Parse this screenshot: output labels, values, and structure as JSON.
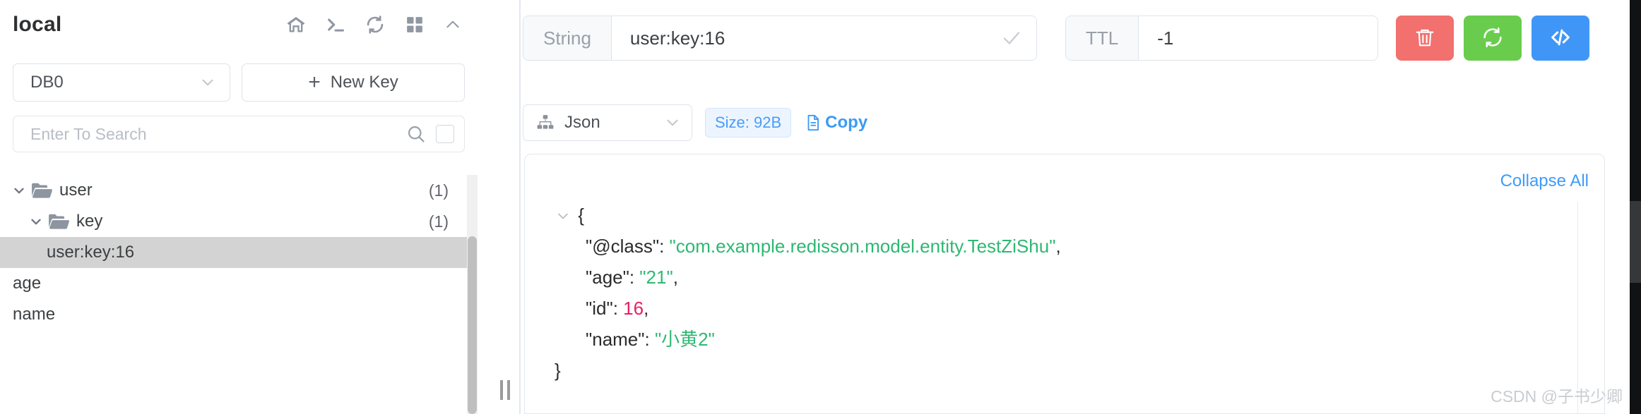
{
  "sidebar": {
    "connection_name": "local",
    "header_icons": [
      {
        "name": "home-icon",
        "label": "Home"
      },
      {
        "name": "terminal-icon",
        "label": "Console"
      },
      {
        "name": "refresh-icon",
        "label": "Refresh"
      },
      {
        "name": "grid-icon",
        "label": "Grid View"
      },
      {
        "name": "chevron-up-icon",
        "label": "Collapse"
      }
    ],
    "db_select": {
      "value": "DB0"
    },
    "new_key_button": {
      "plus": "+",
      "label": "New Key"
    },
    "search": {
      "placeholder": "Enter To Search",
      "value": ""
    },
    "tree": [
      {
        "label": "user",
        "count": "(1)",
        "level": 1,
        "type": "folder",
        "expanded": true,
        "selected": false
      },
      {
        "label": "key",
        "count": "(1)",
        "level": 2,
        "type": "folder",
        "expanded": true,
        "selected": false
      },
      {
        "label": "user:key:16",
        "count": "",
        "level": 3,
        "type": "key",
        "expanded": false,
        "selected": true
      },
      {
        "label": "age",
        "count": "",
        "level": 0,
        "type": "key",
        "expanded": false,
        "selected": false
      },
      {
        "label": "name",
        "count": "",
        "level": 0,
        "type": "key",
        "expanded": false,
        "selected": false
      }
    ]
  },
  "main": {
    "key_type_label": "String",
    "key_name_value": "user:key:16",
    "ttl_label": "TTL",
    "ttl_value": "-1",
    "actions": [
      {
        "name": "delete-key-button",
        "icon": "trash-icon",
        "color": "#f2706e"
      },
      {
        "name": "reload-key-button",
        "icon": "refresh-icon",
        "color": "#69cc4d"
      },
      {
        "name": "view-code-button",
        "icon": "code-icon",
        "color": "#4096f7"
      }
    ],
    "format_select": {
      "value": "Json",
      "icon": "sitemap-icon"
    },
    "size_badge": "Size: 92B",
    "copy_label": "Copy",
    "collapse_all_label": "Collapse All",
    "json_lines": [
      {
        "indent": 0,
        "chevron": true,
        "text": "{"
      },
      {
        "indent": 1,
        "chevron": false,
        "key": "\"@class\"",
        "sep": ": ",
        "value": "\"com.example.redisson.model.entity.TestZiShu\"",
        "value_type": "string",
        "comma": ","
      },
      {
        "indent": 1,
        "chevron": false,
        "key": "\"age\"",
        "sep": ": ",
        "value": "\"21\"",
        "value_type": "string",
        "comma": ","
      },
      {
        "indent": 1,
        "chevron": false,
        "key": "\"id\"",
        "sep": ": ",
        "value": "16",
        "value_type": "number",
        "comma": ","
      },
      {
        "indent": 1,
        "chevron": false,
        "key": "\"name\"",
        "sep": ": ",
        "value": "\"小黄2\"",
        "value_type": "string",
        "comma": ""
      },
      {
        "indent": 0,
        "chevron": false,
        "text": "}"
      }
    ]
  },
  "watermark": "CSDN @子书少卿",
  "colors": {
    "selection": "#d3d3d3",
    "accent_blue": "#3b9bf5",
    "json_string": "#2eb872",
    "json_number": "#e91e63",
    "danger": "#f2706e",
    "success": "#69cc4d",
    "info": "#4096f7"
  }
}
